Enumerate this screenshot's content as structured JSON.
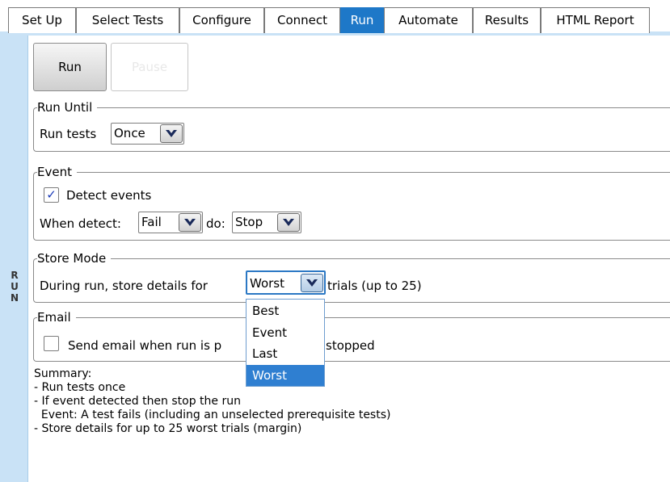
{
  "tabs": [
    {
      "label": "Set Up",
      "active": false
    },
    {
      "label": "Select Tests",
      "active": false
    },
    {
      "label": "Configure",
      "active": false
    },
    {
      "label": "Connect",
      "active": false
    },
    {
      "label": "Run",
      "active": true
    },
    {
      "label": "Automate",
      "active": false
    },
    {
      "label": "Results",
      "active": false
    },
    {
      "label": "HTML Report",
      "active": false
    }
  ],
  "side_label": "RUN",
  "side_letters": [
    "R",
    "U",
    "N"
  ],
  "buttons": {
    "run": "Run",
    "pause": "Pause"
  },
  "run_until": {
    "legend": "Run Until",
    "label": "Run tests",
    "combo_value": "Once"
  },
  "event": {
    "legend": "Event",
    "detect_label": "Detect events",
    "detect_checked": true,
    "when_label": "When detect:",
    "when_value": "Fail",
    "do_label": "do:",
    "do_value": "Stop"
  },
  "store_mode": {
    "legend": "Store Mode",
    "prefix": "During run, store details for",
    "combo_value": "Worst",
    "suffix": "trials (up to 25)",
    "options": [
      "Best",
      "Event",
      "Last",
      "Worst"
    ],
    "selected_option": "Worst"
  },
  "email": {
    "legend": "Email",
    "label_start": "Send email when run is p",
    "label_end": "stopped",
    "checked": false
  },
  "summary": {
    "title": "Summary:",
    "lines": [
      "- Run tests once",
      "- If event detected then stop the run",
      "  Event: A test fails (including an unselected prerequisite tests)",
      "- Store details for up to 25 worst trials (margin)"
    ]
  },
  "colors": {
    "active_tab": "#1e78c8",
    "side_strip": "#c9e2f6",
    "selection": "#2f7fd1",
    "check_mark": "#1a3ab8"
  }
}
